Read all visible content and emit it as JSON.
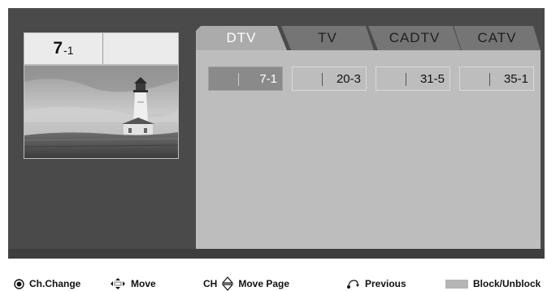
{
  "preview": {
    "channel_main": "7",
    "channel_sub": "-1"
  },
  "tabs": [
    {
      "label": "DTV",
      "active": true
    },
    {
      "label": "TV",
      "active": false
    },
    {
      "label": "CADTV",
      "active": false
    },
    {
      "label": "CATV",
      "active": false
    }
  ],
  "channels": [
    {
      "number": "7-1",
      "selected": true
    },
    {
      "number": "20-3",
      "selected": false
    },
    {
      "number": "31-5",
      "selected": false
    },
    {
      "number": "35-1",
      "selected": false
    }
  ],
  "legend": {
    "ch_change": "Ch.Change",
    "move": "Move",
    "ch_prefix": "CH",
    "move_page": "Move Page",
    "previous": "Previous",
    "block_unblock": "Block/Unblock"
  },
  "icons": {
    "ok": "ok-button-icon",
    "move": "arrow-keys-icon",
    "page": "ch-up-down-icon",
    "previous": "back-return-icon",
    "block": "gray-color-key-icon"
  },
  "colors": {
    "screen_bg": "#4a4a4a",
    "panel_bg": "#bdbdbd",
    "active_tab": "#ababab",
    "inactive_tab": "#757575",
    "selected_channel": "#8a8a8a",
    "block_key": "#b5b5b5"
  }
}
